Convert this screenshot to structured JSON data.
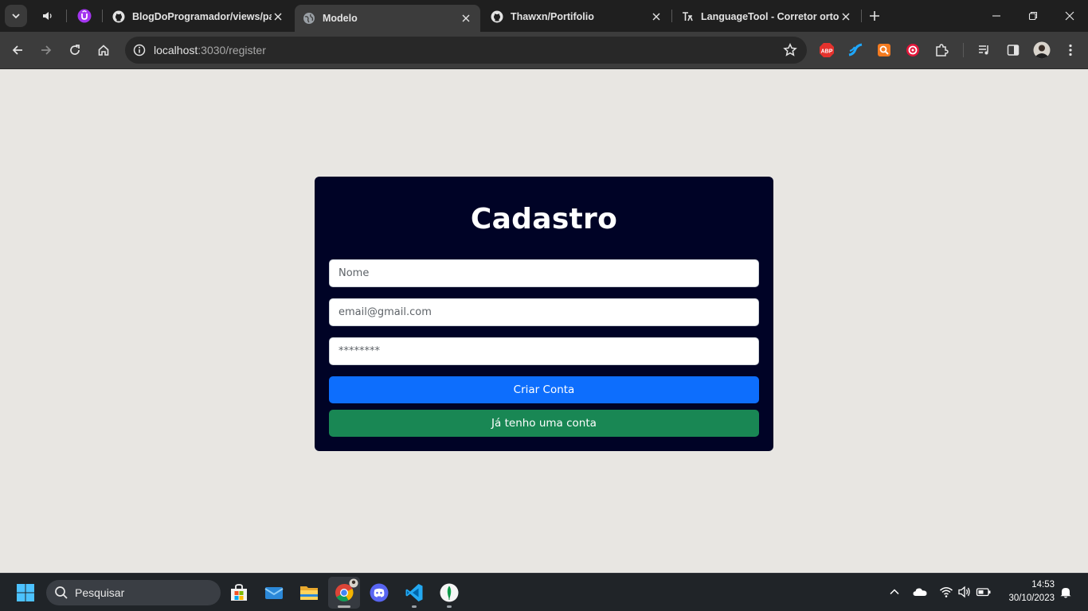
{
  "browser": {
    "tabs": [
      {
        "title": "BlogDoProgramador/views/pages",
        "favicon": "github-icon"
      },
      {
        "title": "Modelo",
        "favicon": "globe-icon",
        "active": true
      },
      {
        "title": "Thawxn/Portifolio",
        "favicon": "github-icon"
      },
      {
        "title": "LanguageTool - Corretor ortográfico",
        "favicon": "languagetool-icon"
      }
    ],
    "url_host": "localhost",
    "url_path": ":3030/register",
    "extensions": [
      "adblock-plus-icon",
      "wave-extension-icon",
      "orange-extension-icon",
      "red-target-extension-icon",
      "puzzle-icon"
    ],
    "extension_labels": {
      "adblock": "ABP"
    }
  },
  "page": {
    "title": "Cadastro",
    "name_placeholder": "Nome",
    "email_placeholder": "email@gmail.com",
    "password_placeholder": "********",
    "create_button": "Criar Conta",
    "login_button": "Já tenho uma conta"
  },
  "taskbar": {
    "search_placeholder": "Pesquisar",
    "time": "14:53",
    "date": "30/10/2023",
    "apps": [
      "windows-store-icon",
      "mail-icon",
      "file-explorer-icon",
      "chrome-icon",
      "discord-icon",
      "vscode-icon",
      "mongodb-compass-icon"
    ]
  },
  "colors": {
    "card_bg": "#000326",
    "primary": "#0d6efd",
    "success": "#198754",
    "page_bg": "#e8e6e2"
  }
}
